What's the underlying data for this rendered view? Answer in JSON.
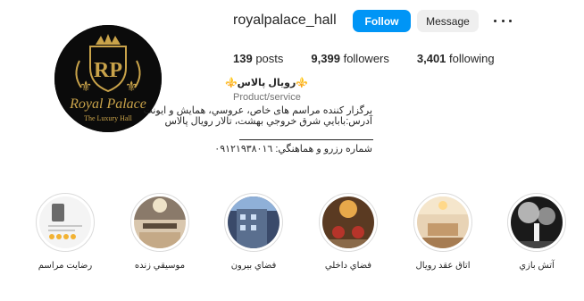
{
  "profile": {
    "username": "royalpalace_hall",
    "follow_label": "Follow",
    "message_label": "Message",
    "more_icon": "more-options-icon"
  },
  "avatar": {
    "monogram": "RP",
    "brand": "Royal Palace",
    "tagline": "The Luxury Hall"
  },
  "stats": {
    "posts_count": "139",
    "posts_label": "posts",
    "followers_count": "9,399",
    "followers_label": "followers",
    "following_count": "3,401",
    "following_label": "following"
  },
  "bio": {
    "display_name": "⚜️رويال پالاس⚜️",
    "category": "Product/service",
    "line1": "برگزار کننده مراسم های خاص، عروسي، همايش و ايونت",
    "line2": "آدرس:بابايي شرق خروجي بهشت، تالار رويال پالاس",
    "contact": "شماره رزرو و هماهنگي: ٠٩١٢١٩٣٨٠١٦"
  },
  "highlights": [
    {
      "label": "رضايت مراسم"
    },
    {
      "label": "موسيقي زنده"
    },
    {
      "label": "فضاي بيرون"
    },
    {
      "label": "فضاي داخلي"
    },
    {
      "label": "اتاق عقد رويال"
    },
    {
      "label": "آتش بازي"
    }
  ],
  "colors": {
    "follow_blue": "#0095f6",
    "message_gray": "#efefef",
    "gold": "#c9a34a"
  }
}
